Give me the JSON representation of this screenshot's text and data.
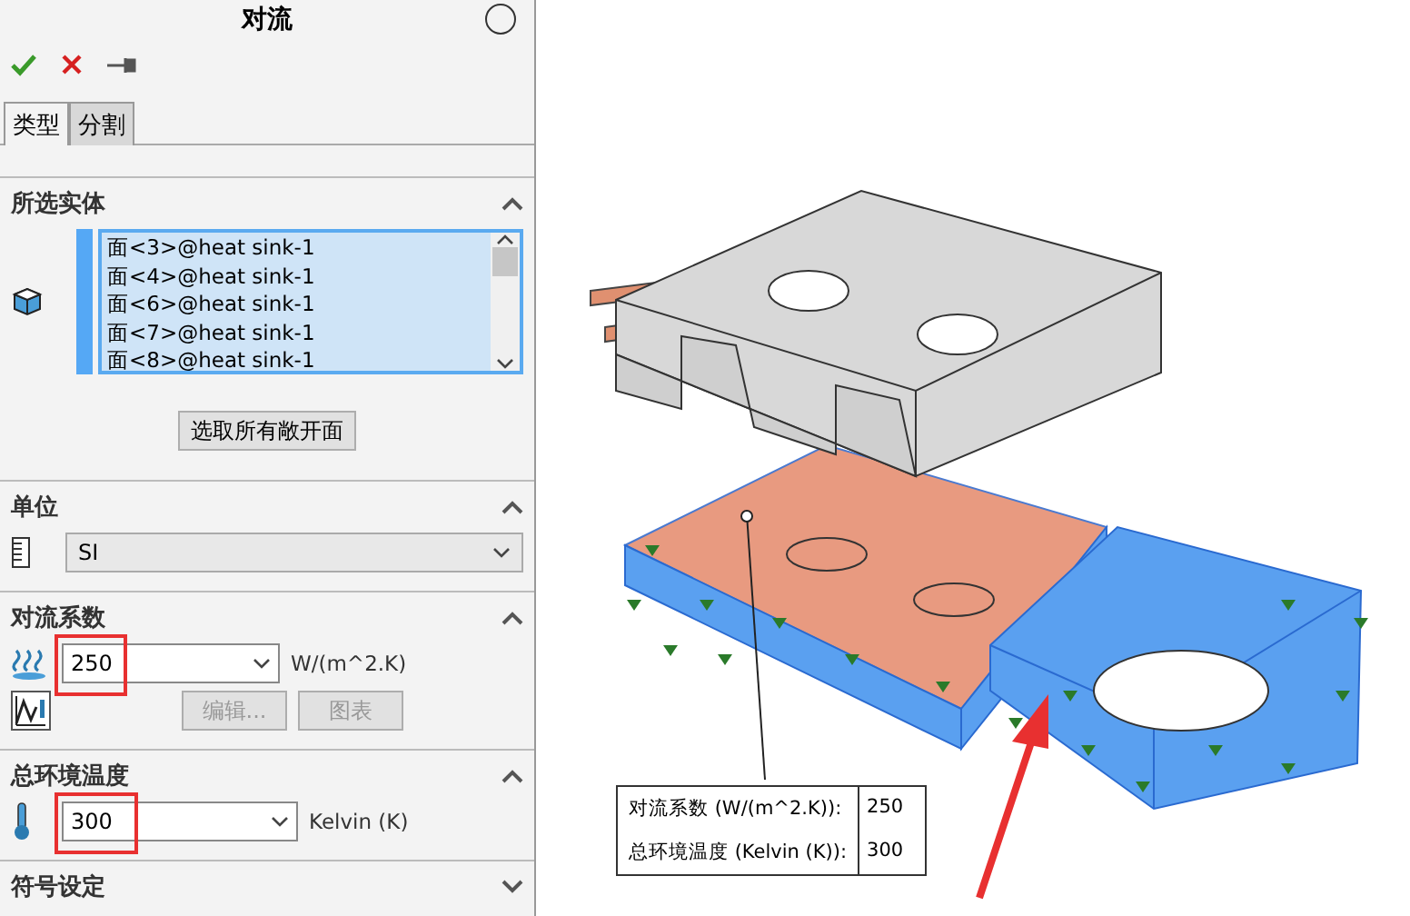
{
  "panel": {
    "title": "对流",
    "tabs": [
      {
        "label": "类型",
        "selected": true
      },
      {
        "label": "分割",
        "selected": false
      }
    ]
  },
  "selected_entities": {
    "title": "所选实体",
    "expanded": true,
    "items": [
      "面<3>@heat sink-1",
      "面<4>@heat sink-1",
      "面<6>@heat sink-1",
      "面<7>@heat sink-1",
      "面<8>@heat sink-1"
    ],
    "button": "选取所有敞开面"
  },
  "units": {
    "title": "单位",
    "expanded": true,
    "value": "SI"
  },
  "convection": {
    "title": "对流系数",
    "expanded": true,
    "value": "250",
    "unit": "W/(m^2.K)",
    "highlighted": true,
    "buttons": [
      {
        "label": "编辑...",
        "disabled": true
      },
      {
        "label": "图表",
        "disabled": true
      }
    ]
  },
  "ambient": {
    "title": "总环境温度",
    "expanded": true,
    "value": "300",
    "unit": "Kelvin (K)",
    "highlighted": true
  },
  "symbol_settings": {
    "title": "符号设定",
    "expanded": false
  },
  "callout": {
    "rows": [
      {
        "label": "对流系数 (W/(m^2.K)):",
        "value": "250"
      },
      {
        "label": "总环境温度 (Kelvin (K)):",
        "value": "300"
      }
    ]
  }
}
